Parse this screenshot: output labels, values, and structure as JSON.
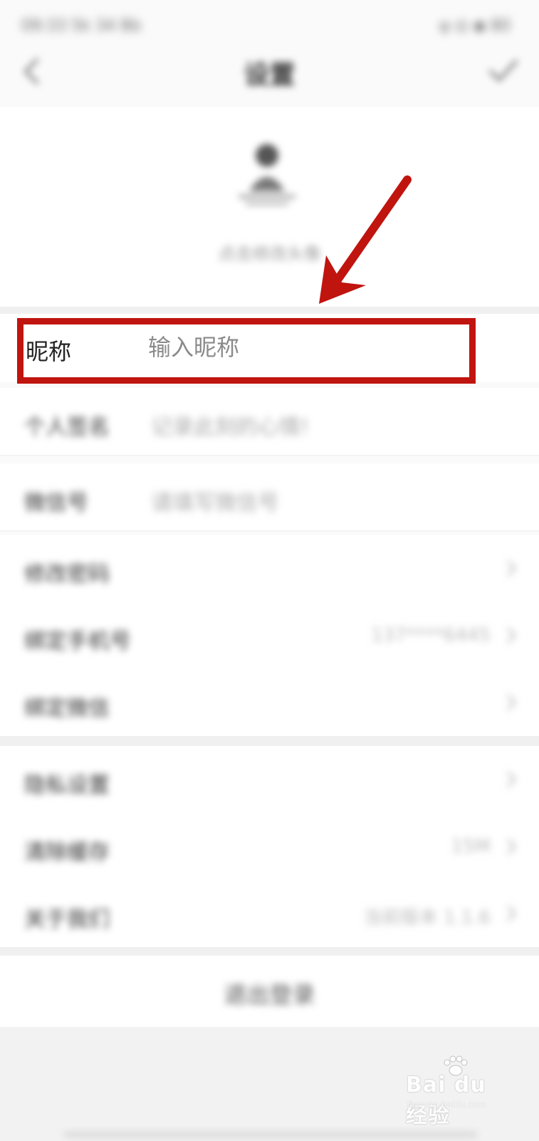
{
  "status_bar": {
    "left_text": "09:33 5k 34 Bb",
    "right_text": "ψ ◎ ◆ 80"
  },
  "header": {
    "title": "设置"
  },
  "avatar_block": {
    "hint": "点击修改头像"
  },
  "nickname": {
    "label": "昵称",
    "placeholder": "输入昵称"
  },
  "profile_rows": [
    {
      "label": "个人签名",
      "value": "记录此刻的心情!"
    },
    {
      "label": "微信号",
      "value": "请填写微信号"
    }
  ],
  "account_rows": [
    {
      "label": "修改密码",
      "right": ""
    },
    {
      "label": "绑定手机号",
      "right": "137****6445"
    },
    {
      "label": "绑定微信",
      "right": ""
    }
  ],
  "other_rows": [
    {
      "label": "隐私设置",
      "right": ""
    },
    {
      "label": "清除缓存",
      "right": "15M"
    },
    {
      "label": "关于我们",
      "right": "当前版本 1.1.6"
    }
  ],
  "logout": {
    "label": "退出登录"
  },
  "watermark": {
    "main": "Bai du 经验",
    "sub": "jingyan.baidu.com"
  },
  "colors": {
    "highlight": "#c0140f"
  }
}
